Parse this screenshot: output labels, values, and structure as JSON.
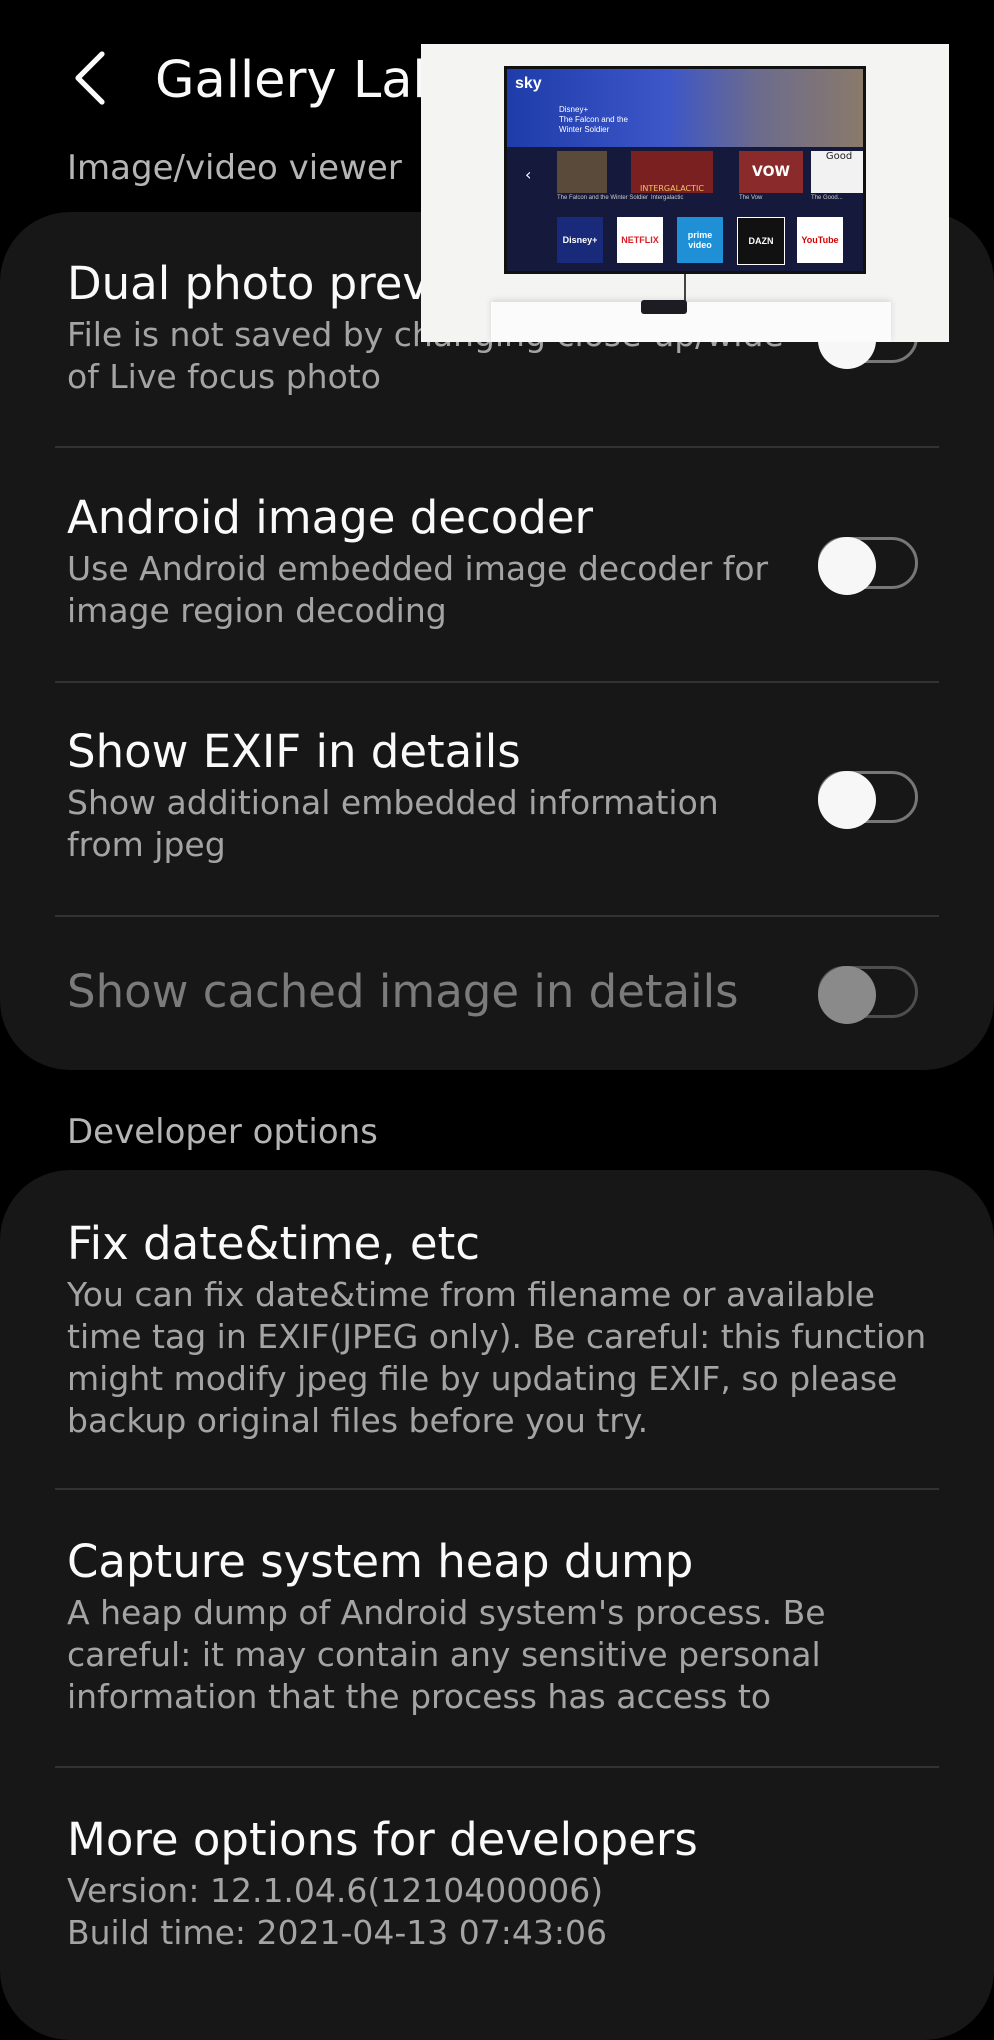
{
  "header": {
    "title": "Gallery Labs",
    "section_top": "Image/video viewer"
  },
  "viewer_settings": [
    {
      "title": "Dual photo preview",
      "subtitle": "File is not saved by changing close-up/wide of Live focus photo",
      "toggle_on": false,
      "enabled": true
    },
    {
      "title": "Android image decoder",
      "subtitle": "Use Android embedded image decoder for image region decoding",
      "toggle_on": false,
      "enabled": true
    },
    {
      "title": "Show EXIF in details",
      "subtitle": "Show additional embedded information from jpeg",
      "toggle_on": false,
      "enabled": true
    },
    {
      "title": "Show cached image in details",
      "subtitle": "",
      "toggle_on": false,
      "enabled": false
    }
  ],
  "developer": {
    "label": "Developer options",
    "items": [
      {
        "title": "Fix date&time, etc",
        "subtitle": "You can fix date&time from filename or available time tag in EXIF(JPEG only). Be careful: this function might modify jpeg file by updating EXIF, so please backup original files before you try."
      },
      {
        "title": "Capture system heap dump",
        "subtitle": "A heap dump of Android system's process. Be careful: it may contain any sensitive personal information that the process has access to"
      },
      {
        "title": "More options for developers",
        "version": "Version: 12.1.04.6(1210400006)",
        "build": "Build time: 2021-04-13 07:43:06"
      }
    ]
  },
  "overlay": {
    "brand": "sky",
    "hero_line1": "Disney+",
    "hero_line2": "The Falcon and the",
    "hero_line3": "Winter Soldier",
    "tile_captions": [
      "The Falcon and the Winter Soldier",
      "Intergalactic",
      "The Vow",
      "The Good..."
    ],
    "tile_labels": [
      "",
      "INTERGALACTIC",
      "VOW",
      "Good"
    ],
    "apps": [
      "Disney+",
      "NETFLIX",
      "prime video",
      "DAZN",
      "YouTube"
    ]
  },
  "colors": {
    "background": "#000000",
    "card": "#171717",
    "primary_text": "#fafafa",
    "secondary_text": "#a4a4a4",
    "disabled_text": "#7b7b7b"
  }
}
